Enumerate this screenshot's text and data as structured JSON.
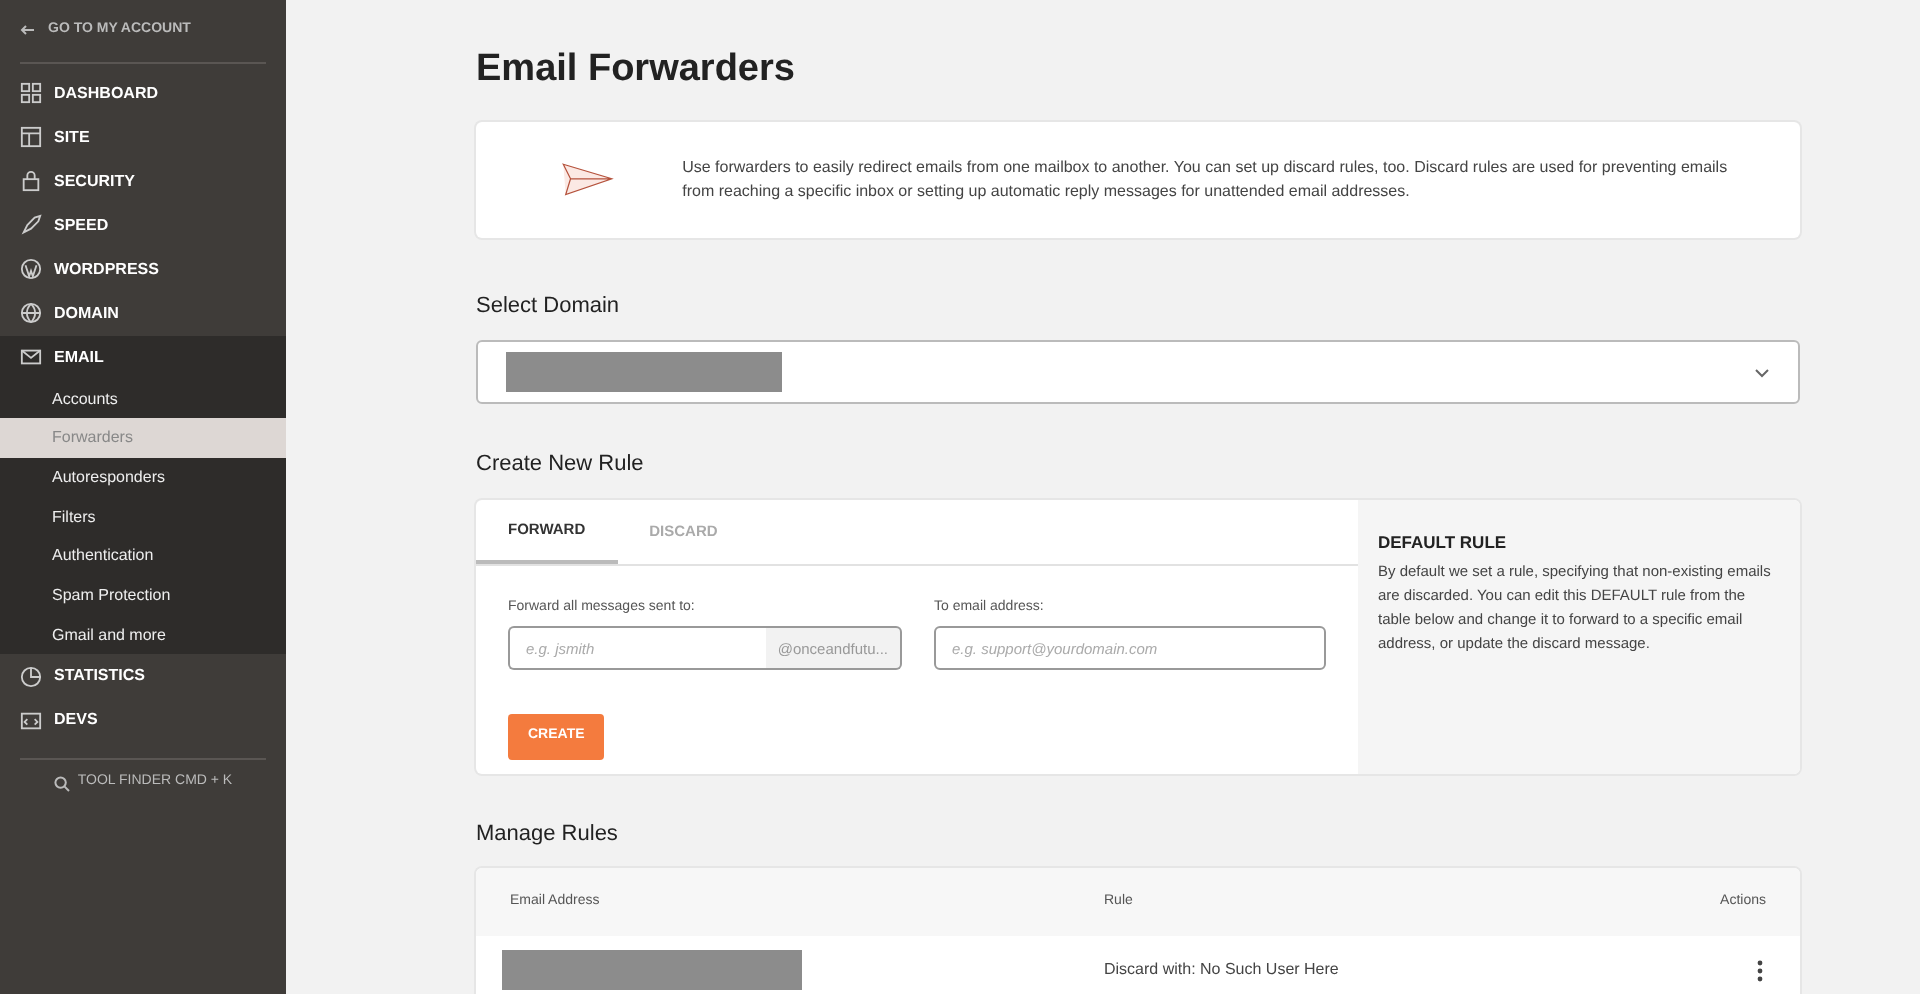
{
  "sidebar": {
    "back_link": "GO TO MY ACCOUNT",
    "items": [
      {
        "label": "DASHBOARD",
        "expanded": false
      },
      {
        "label": "SITE",
        "expanded": false
      },
      {
        "label": "SECURITY",
        "expanded": false
      },
      {
        "label": "SPEED",
        "expanded": false
      },
      {
        "label": "WORDPRESS",
        "expanded": false
      },
      {
        "label": "DOMAIN",
        "expanded": false
      },
      {
        "label": "EMAIL",
        "expanded": true,
        "children": [
          {
            "label": "Accounts",
            "selected": false
          },
          {
            "label": "Forwarders",
            "selected": true
          },
          {
            "label": "Autoresponders",
            "selected": false
          },
          {
            "label": "Filters",
            "selected": false
          },
          {
            "label": "Authentication",
            "selected": false
          },
          {
            "label": "Spam Protection",
            "selected": false
          },
          {
            "label": "Gmail and more",
            "selected": false
          }
        ]
      },
      {
        "label": "STATISTICS",
        "expanded": false
      },
      {
        "label": "DEVS",
        "expanded": false
      }
    ],
    "tool_finder": "TOOL FINDER CMD + K"
  },
  "page_title": "Email Forwarders",
  "intro": "Use forwarders to easily redirect emails from one mailbox to another. You can set up discard rules, too. Discard rules are used for preventing emails from reaching a specific inbox or setting up automatic reply messages for unattended email addresses.",
  "select_domain": {
    "heading": "Select Domain"
  },
  "create_rule": {
    "heading": "Create New Rule",
    "tabs": [
      {
        "label": "FORWARD",
        "selected": true
      },
      {
        "label": "DISCARD",
        "selected": false
      }
    ],
    "from_label": "Forward all messages sent to:",
    "from_placeholder": "e.g. jsmith",
    "domain_suffix": "@onceandfutu...",
    "to_label": "To email address:",
    "to_placeholder": "e.g. support@yourdomain.com",
    "button": "CREATE",
    "default_rule": {
      "title": "DEFAULT RULE",
      "text": "By default we set a rule, specifying that non-existing emails are discarded. You can edit this DEFAULT rule from the table below and change it to forward to a specific email address, or update the discard message."
    }
  },
  "manage_rules": {
    "heading": "Manage Rules",
    "columns": [
      "Email Address",
      "Rule",
      "Actions"
    ],
    "rows": [
      {
        "rule": "Discard with: No Such User Here"
      }
    ]
  }
}
